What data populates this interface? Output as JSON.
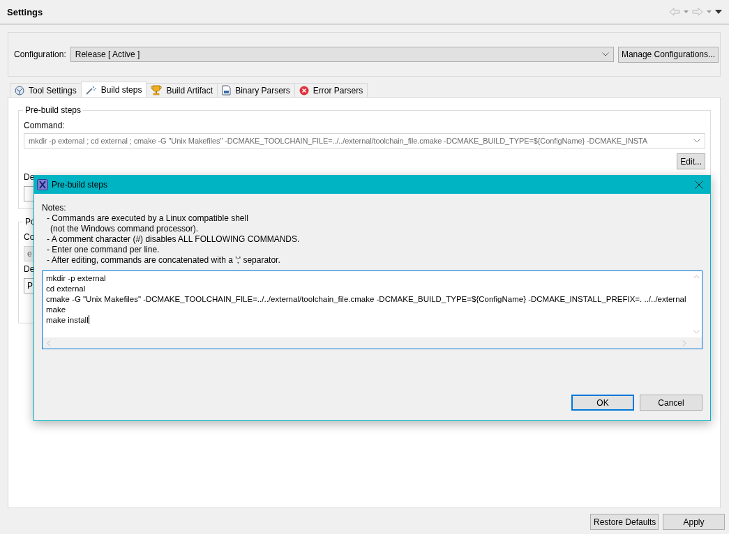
{
  "view": {
    "title": "Settings"
  },
  "configuration": {
    "label": "Configuration:",
    "value": "Release  [ Active ]",
    "button": "Manage Configurations..."
  },
  "tabs": [
    {
      "label": "Tool Settings",
      "selected": false,
      "kind": "tool"
    },
    {
      "label": "Build steps",
      "selected": true,
      "kind": "steps"
    },
    {
      "label": "Build Artifact",
      "selected": false,
      "kind": "artifact"
    },
    {
      "label": "Binary Parsers",
      "selected": false,
      "kind": "binary"
    },
    {
      "label": "Error Parsers",
      "selected": false,
      "kind": "error"
    }
  ],
  "prebuild": {
    "title": "Pre-build steps",
    "command_label": "Command:",
    "command_value": "mkdir -p external ; cd external ; cmake -G \"Unix Makefiles\" -DCMAKE_TOOLCHAIN_FILE=../../external/toolchain_file.cmake -DCMAKE_BUILD_TYPE=${ConfigName} -DCMAKE_INSTA",
    "edit_button": "Edit...",
    "description_label": "De"
  },
  "postbuild": {
    "title": "Po",
    "command_label": "Co",
    "command_value": "e",
    "description_label": "De",
    "description_value": "P"
  },
  "buttons": [
    "Restore Defaults",
    "Apply"
  ],
  "dialog": {
    "title": "Pre-build steps",
    "notes_heading": "Notes:",
    "notes": [
      {
        "text": "- Commands are executed by a Linux compatible shell",
        "continuation": "(not the Windows command processor)."
      },
      {
        "text": "- A comment character (#) disables ALL FOLLOWING COMMANDS."
      },
      {
        "text": "- Enter one command per line."
      },
      {
        "text": "- After editing, commands are concatenated with a ';' separator."
      }
    ],
    "lines": [
      "mkdir -p external",
      "cd external",
      "cmake -G \"Unix Makefiles\" -DCMAKE_TOOLCHAIN_FILE=../../external/toolchain_file.cmake -DCMAKE_BUILD_TYPE=${ConfigName} -DCMAKE_INSTALL_PREFIX=. ../../external",
      "make",
      "make install"
    ],
    "buttons": [
      {
        "label": "OK",
        "default": true
      },
      {
        "label": "Cancel",
        "default": false
      }
    ]
  }
}
